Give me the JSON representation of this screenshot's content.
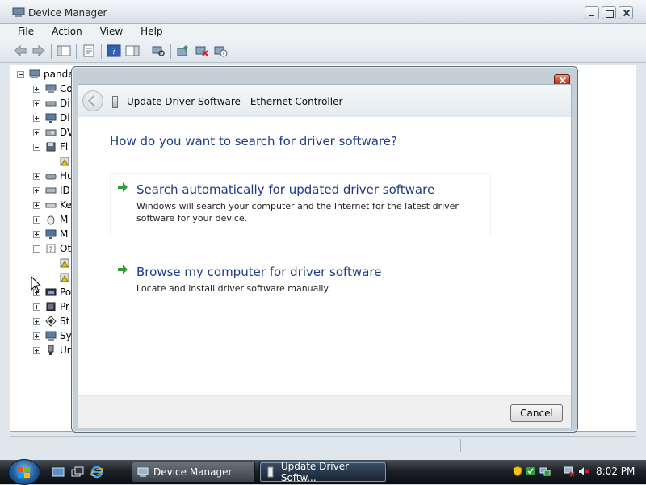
{
  "window": {
    "title": "Device Manager",
    "icon": "computer-management-icon"
  },
  "menubar": {
    "items": [
      "File",
      "Action",
      "View",
      "Help"
    ]
  },
  "toolbar": {
    "icons": [
      "back-icon",
      "forward-icon",
      "show-hide-console-tree-icon",
      "properties-icon",
      "help-icon",
      "action-pane-icon",
      "scan-hardware-icon",
      "update-driver-icon",
      "uninstall-icon",
      "disable-icon"
    ]
  },
  "tree": {
    "root": "pande",
    "items": [
      {
        "label": "Co",
        "icon": "computer-icon",
        "expanded": false
      },
      {
        "label": "Di",
        "icon": "disk-drive-icon",
        "expanded": false
      },
      {
        "label": "Di",
        "icon": "display-adapter-icon",
        "expanded": false
      },
      {
        "label": "DV",
        "icon": "dvd-drive-icon",
        "expanded": false
      },
      {
        "label": "Fl",
        "icon": "floppy-controller-icon",
        "expanded": true
      },
      {
        "label": "",
        "icon": "warning-device-icon",
        "child": true
      },
      {
        "label": "Hu",
        "icon": "hid-icon",
        "expanded": false
      },
      {
        "label": "ID",
        "icon": "ide-controller-icon",
        "expanded": false
      },
      {
        "label": "Ke",
        "icon": "keyboard-icon",
        "expanded": false
      },
      {
        "label": "M",
        "icon": "mouse-icon",
        "expanded": false
      },
      {
        "label": "M",
        "icon": "monitor-icon",
        "expanded": false
      },
      {
        "label": "Ot",
        "icon": "other-devices-icon",
        "expanded": true
      },
      {
        "label": "",
        "icon": "warning-device-icon",
        "child": true
      },
      {
        "label": "",
        "icon": "warning-device-icon",
        "child": true
      },
      {
        "label": "Po",
        "icon": "port-icon",
        "expanded": false
      },
      {
        "label": "Pr",
        "icon": "processor-icon",
        "expanded": false
      },
      {
        "label": "St",
        "icon": "storage-controller-icon",
        "expanded": false
      },
      {
        "label": "Sy",
        "icon": "system-devices-icon",
        "expanded": false
      },
      {
        "label": "Ur",
        "icon": "usb-controller-icon",
        "expanded": false
      }
    ]
  },
  "dialog": {
    "title": "Update Driver Software - Ethernet Controller",
    "question": "How do you want to search for driver software?",
    "options": [
      {
        "title": "Search automatically for updated driver software",
        "description": "Windows will search your computer and the Internet for the latest driver software for your device."
      },
      {
        "title": "Browse my computer for driver software",
        "description": "Locate and install driver software manually."
      }
    ],
    "cancel_label": "Cancel"
  },
  "taskbar": {
    "quick_launch": [
      "show-desktop-icon",
      "switch-windows-icon",
      "internet-explorer-icon"
    ],
    "tasks": [
      {
        "label": "Device Manager",
        "icon": "computer-management-icon",
        "active": false
      },
      {
        "label": "Update Driver Softw...",
        "icon": "device-icon",
        "active": true
      }
    ],
    "tray_icons": [
      "windows-defender-icon",
      "security-center-icon",
      "network-icon",
      "network-disconnected-icon",
      "volume-muted-icon"
    ],
    "clock": "8:02 PM"
  },
  "colors": {
    "link_blue": "#1c3a86",
    "arrow_green": "#2e9e3a",
    "close_red": "#c44a32"
  }
}
